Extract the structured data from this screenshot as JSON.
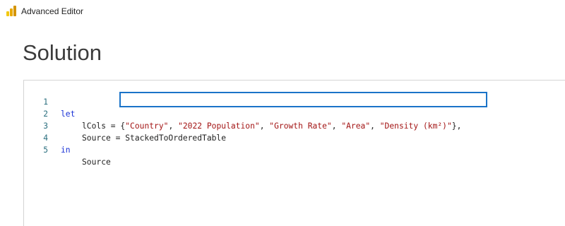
{
  "window": {
    "title": "Advanced Editor",
    "app_icon": "power-bi-icon"
  },
  "page": {
    "heading": "Solution"
  },
  "editor": {
    "lines": [
      {
        "number": "1",
        "keyword": "let"
      },
      {
        "number": "2",
        "prefix": "lCols = ",
        "open": "{",
        "strings": [
          "\"Country\"",
          "\"2022 Population\"",
          "\"Growth Rate\"",
          "\"Area\"",
          "\"Density (km²)\""
        ],
        "separator": ", ",
        "close": "},"
      },
      {
        "number": "3",
        "text": "Source = StackedToOrderedTable"
      },
      {
        "number": "4",
        "keyword": "in"
      },
      {
        "number": "5",
        "text": "Source"
      }
    ]
  },
  "colors": {
    "keyword": "#1a32d6",
    "string": "#a31515",
    "line_number": "#2b6f7f",
    "highlight": "#1a73c8"
  }
}
